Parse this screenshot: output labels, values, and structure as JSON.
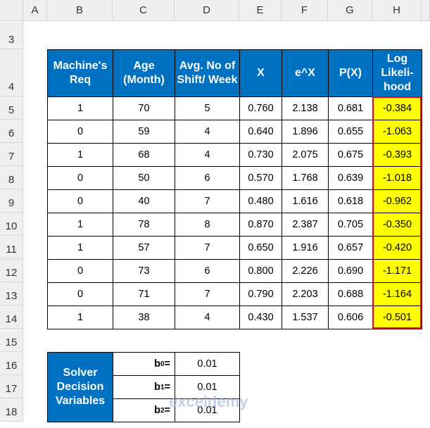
{
  "columns": [
    "A",
    "B",
    "C",
    "D",
    "E",
    "F",
    "G",
    "H"
  ],
  "rows": [
    "3",
    "4",
    "5",
    "6",
    "7",
    "8",
    "9",
    "10",
    "11",
    "12",
    "13",
    "14",
    "15",
    "16",
    "17",
    "18"
  ],
  "table": {
    "headers": [
      "Machine's Req",
      "Age (Month)",
      "Avg. No of Shift/ Week",
      "X",
      "e^X",
      "P(X)",
      "Log Likeli-hood"
    ],
    "data": [
      [
        "1",
        "70",
        "5",
        "0.760",
        "2.138",
        "0.681",
        "-0.384"
      ],
      [
        "0",
        "59",
        "4",
        "0.640",
        "1.896",
        "0.655",
        "-1.063"
      ],
      [
        "1",
        "68",
        "4",
        "0.730",
        "2.075",
        "0.675",
        "-0.393"
      ],
      [
        "0",
        "50",
        "6",
        "0.570",
        "1.768",
        "0.639",
        "-1.018"
      ],
      [
        "0",
        "40",
        "7",
        "0.480",
        "1.616",
        "0.618",
        "-0.962"
      ],
      [
        "1",
        "78",
        "8",
        "0.870",
        "2.387",
        "0.705",
        "-0.350"
      ],
      [
        "1",
        "57",
        "7",
        "0.650",
        "1.916",
        "0.657",
        "-0.420"
      ],
      [
        "0",
        "73",
        "6",
        "0.800",
        "2.226",
        "0.690",
        "-1.171"
      ],
      [
        "0",
        "71",
        "7",
        "0.790",
        "2.203",
        "0.688",
        "-1.164"
      ],
      [
        "1",
        "38",
        "4",
        "0.430",
        "1.537",
        "0.606",
        "-0.501"
      ]
    ]
  },
  "solver": {
    "label": "Solver Decision Variables",
    "vars": [
      {
        "b": "b",
        "sub": "0",
        "eq": " =",
        "value": "0.01"
      },
      {
        "b": "b",
        "sub": "1",
        "eq": " =",
        "value": "0.01"
      },
      {
        "b": "b",
        "sub": "2",
        "eq": " =",
        "value": "0.01"
      }
    ]
  },
  "watermark": "exceldemy",
  "colors": {
    "header": "#0070c0",
    "highlight": "#ffff00",
    "selection_border": "#e00000"
  }
}
